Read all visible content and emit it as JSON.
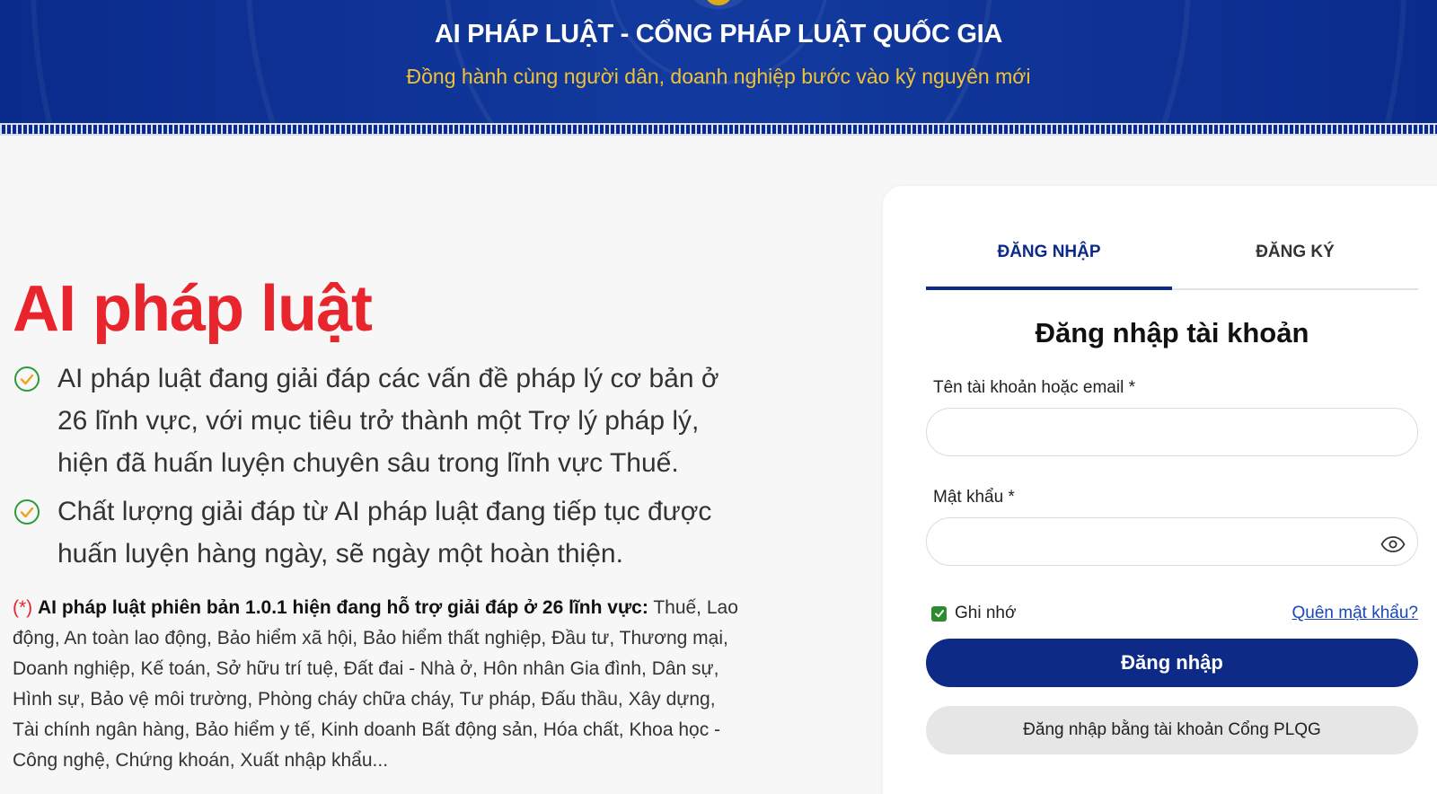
{
  "header": {
    "title": "AI PHÁP LUẬT - CỔNG PHÁP LUẬT QUỐC GIA",
    "subtitle": "Đồng hành cùng người dân, doanh nghiệp bước vào kỷ nguyên mới",
    "background_color": "#0a2a8a",
    "subtitle_color": "#f1c233"
  },
  "hero": {
    "title": "AI pháp luật",
    "title_color": "#e8252c",
    "bullets": [
      {
        "icon": "check-circle-icon",
        "text": "AI pháp luật đang giải đáp các vấn đề pháp lý cơ bản ở 26 lĩnh vực, với mục tiêu trở thành một Trợ lý pháp lý, hiện đã huấn luyện chuyên sâu trong lĩnh vực Thuế."
      },
      {
        "icon": "check-circle-icon",
        "text": "Chất lượng giải đáp từ AI pháp luật đang tiếp tục được huấn luyện hàng ngày, sẽ ngày một hoàn thiện."
      }
    ],
    "note": {
      "marker": "(*)",
      "bold": "AI pháp luật phiên bản 1.0.1 hiện đang hỗ trợ giải đáp ở 26 lĩnh vực:",
      "text": "Thuế, Lao động, An toàn lao động, Bảo hiểm xã hội, Bảo hiểm thất nghiệp, Đầu tư, Thương mại, Doanh nghiệp, Kế toán, Sở hữu trí tuệ, Đất đai - Nhà ở, Hôn nhân Gia đình, Dân sự, Hình sự, Bảo vệ môi trường, Phòng cháy chữa cháy, Tư pháp, Đấu thầu, Xây dựng, Tài chính ngân hàng, Bảo hiểm y tế, Kinh doanh Bất động sản, Hóa chất, Khoa học - Công nghệ, Chứng khoán, Xuất nhập khẩu..."
    }
  },
  "login": {
    "tabs": [
      {
        "label": "ĐĂNG NHẬP",
        "active": true
      },
      {
        "label": "ĐĂNG KÝ",
        "active": false
      }
    ],
    "form_title": "Đăng nhập tài khoản",
    "username_label": "Tên tài khoản hoặc email *",
    "username_value": "",
    "password_label": "Mật khẩu *",
    "password_value": "",
    "password_toggle_icon": "eye-icon",
    "remember_label": "Ghi nhớ",
    "remember_checked": true,
    "forgot_label": "Quên mật khẩu?",
    "submit_label": "Đăng nhập",
    "alt_login_label": "Đăng nhập bằng tài khoản Cổng PLQG",
    "primary_color": "#0c2a86"
  }
}
